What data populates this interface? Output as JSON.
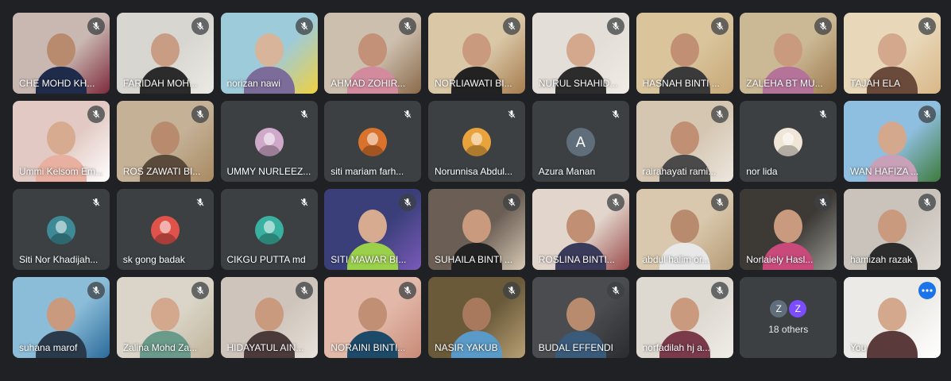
{
  "participants": [
    {
      "name": "CHE MOHD KH...",
      "kind": "video",
      "bg": "#c9b7b2",
      "scene": "#7d2a3b",
      "skin": "#b98b6e",
      "cloth": "#1f2b4a"
    },
    {
      "name": "FARIDAH MOH...",
      "kind": "video",
      "bg": "#d8d6d0",
      "scene": "#eceae4",
      "skin": "#c89d83",
      "cloth": "#2b2b2b"
    },
    {
      "name": "norizan nawi",
      "kind": "video",
      "bg": "#9ecbd9",
      "scene": "#f0d040",
      "skin": "#d8b49a",
      "cloth": "#7b6c9a"
    },
    {
      "name": "AHMAD ZOHIR...",
      "kind": "video",
      "bg": "#cdbfae",
      "scene": "#8a6a4a",
      "skin": "#c29177",
      "cloth": "#d28b9c"
    },
    {
      "name": "NORLIAWATI BI...",
      "kind": "video",
      "bg": "#d9c7a6",
      "scene": "#a67c4e",
      "skin": "#c99a7e",
      "cloth": "#222222"
    },
    {
      "name": "NURUL SHAHID...",
      "kind": "video",
      "bg": "#e3ded7",
      "scene": "#f0ece6",
      "skin": "#d3a88d",
      "cloth": "#2c2c2c"
    },
    {
      "name": "HASNAH BINTI ...",
      "kind": "video",
      "bg": "#d9c49c",
      "scene": "#c7a877",
      "skin": "#c08f74",
      "cloth": "#3a3a3a"
    },
    {
      "name": "ZALEHA BT MU...",
      "kind": "video",
      "bg": "#cbb894",
      "scene": "#9d7a4e",
      "skin": "#c99a7e",
      "cloth": "#b5739a"
    },
    {
      "name": "TAJAH ELA",
      "kind": "video",
      "bg": "#e8d7b8",
      "scene": "#d8b787",
      "skin": "#d3a88d",
      "cloth": "#6a4a3a"
    },
    {
      "name": "Ummi Kelsom Em...",
      "kind": "video",
      "bg": "#e2c9c3",
      "scene": "#ffffff",
      "skin": "#d6ab8f",
      "cloth": "#e8b0a0"
    },
    {
      "name": "ROS ZAWATI BI...",
      "kind": "video",
      "bg": "#c4b196",
      "scene": "#a88a62",
      "skin": "#b98b6e",
      "cloth": "#5a4a3c"
    },
    {
      "name": "UMMY NURLEEZ...",
      "kind": "avatar",
      "avatar": "#cfa9c9"
    },
    {
      "name": "siti mariam farh...",
      "kind": "avatar",
      "avatar": "#d9722c"
    },
    {
      "name": "Norunnisa Abdul...",
      "kind": "avatar",
      "avatar": "#e8a33c"
    },
    {
      "name": "Azura Manan",
      "kind": "letter",
      "letter": "A",
      "avatar": "#5f6e7a"
    },
    {
      "name": "rairahayati rami...",
      "kind": "video",
      "bg": "#d5c6b1",
      "scene": "#ece7df",
      "skin": "#c08f74",
      "cloth": "#4a4a4a"
    },
    {
      "name": "nor lida",
      "kind": "avatar",
      "avatar": "#efe6d8"
    },
    {
      "name": "WAN HAFIZA ...",
      "kind": "video",
      "bg": "#8fbfe0",
      "scene": "#3d7a3a",
      "skin": "#d3a88d",
      "cloth": "#c8a0b8"
    },
    {
      "name": "Siti Nor Khadijah...",
      "kind": "avatar",
      "avatar": "#3d8a96"
    },
    {
      "name": "sk gong badak",
      "kind": "avatar",
      "avatar": "#e0534a"
    },
    {
      "name": "CIKGU PUTTA md",
      "kind": "avatar",
      "avatar": "#3ab0a0"
    },
    {
      "name": "SITI MAWAR BI...",
      "kind": "video",
      "bg": "#3a3f7a",
      "scene": "#7a5ab8",
      "skin": "#d6ab8f",
      "cloth": "#9bd04a"
    },
    {
      "name": "SUHAILA BINTI ...",
      "kind": "video",
      "bg": "#6b5f55",
      "scene": "#d8c9b4",
      "skin": "#c99a7e",
      "cloth": "#222222"
    },
    {
      "name": "ROSLINA BINTI...",
      "kind": "video",
      "bg": "#e2d6cc",
      "scene": "#9a4a4a",
      "skin": "#c08f74",
      "cloth": "#3a3a5a"
    },
    {
      "name": "abdul halim or...",
      "kind": "video",
      "bg": "#d9c8ad",
      "scene": "#b59a74",
      "skin": "#b98b6e",
      "cloth": "#e8e8e8"
    },
    {
      "name": "Norlaiely Hasl...",
      "kind": "video",
      "bg": "#3d3a36",
      "scene": "#9a9a94",
      "skin": "#c99a7e",
      "cloth": "#c84a7a"
    },
    {
      "name": "hamizah razak",
      "kind": "video",
      "bg": "#c9c3bc",
      "scene": "#e0dbd4",
      "skin": "#c99a7e",
      "cloth": "#2c2c2c"
    },
    {
      "name": "suhana marof",
      "kind": "video",
      "bg": "#8bbcd8",
      "scene": "#2a6a9a",
      "skin": "#c99a7e",
      "cloth": "#2a3a4a"
    },
    {
      "name": "Zalina Mohd Za...",
      "kind": "video",
      "bg": "#dad5c8",
      "scene": "#c0b49a",
      "skin": "#d3a88d",
      "cloth": "#6a9a8a"
    },
    {
      "name": "HIDAYATUL AIN...",
      "kind": "video",
      "bg": "#cec4bb",
      "scene": "#e8e2da",
      "skin": "#c99a7e",
      "cloth": "#4a3a3a"
    },
    {
      "name": "NORAINI BINTI...",
      "kind": "video",
      "bg": "#e2b8a8",
      "scene": "#c88a78",
      "skin": "#c08f74",
      "cloth": "#1e4a6a"
    },
    {
      "name": "NASIR YAKUB",
      "kind": "video",
      "bg": "#6a5a3a",
      "scene": "#b8a074",
      "skin": "#a8795c",
      "cloth": "#5a9ac8"
    },
    {
      "name": "BUDAL EFFENDI",
      "kind": "video",
      "bg": "#4a4c50",
      "scene": "#2a2c30",
      "skin": "#b98b6e",
      "cloth": "#3a5a7a"
    },
    {
      "name": "norfadilah hj a...",
      "kind": "video",
      "bg": "#ddd8d0",
      "scene": "#f0ede8",
      "skin": "#c99a7e",
      "cloth": "#7a3a4a"
    },
    {
      "name": "18 others",
      "kind": "others",
      "z1": "#5f6e7a",
      "z2": "#7c4dff"
    },
    {
      "name": "You",
      "kind": "self",
      "bg": "#eceae6",
      "scene": "#ffffff",
      "skin": "#d3a88d",
      "cloth": "#5a3a3a"
    }
  ]
}
